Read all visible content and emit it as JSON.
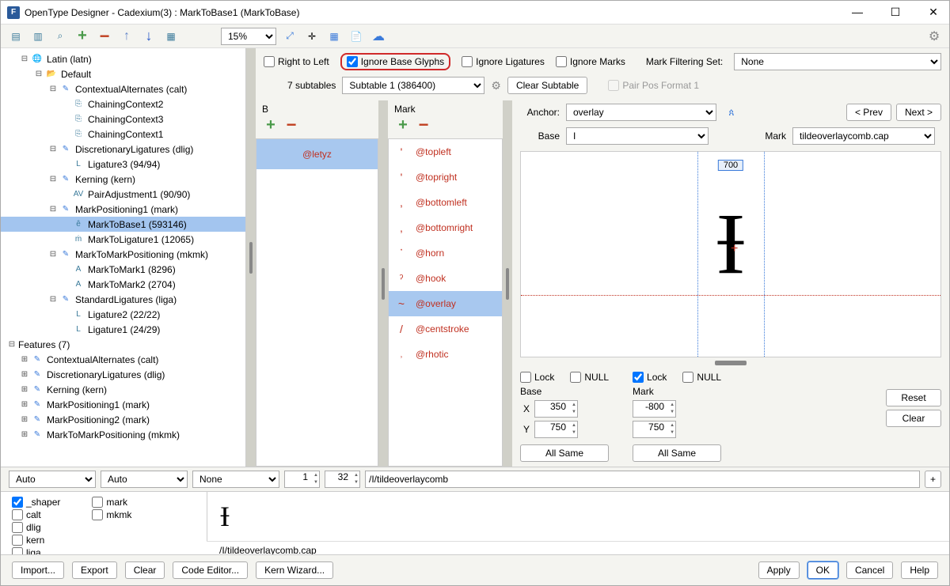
{
  "title": "OpenType Designer - Cadexium(3) : MarkToBase1 (MarkToBase)",
  "zoom": "15%",
  "options": {
    "rtl": "Right to Left",
    "ignoreBase": "Ignore Base Glyphs",
    "ignoreLig": "Ignore Ligatures",
    "ignoreMarks": "Ignore Marks",
    "mfs_label": "Mark Filtering Set:",
    "mfs_value": "None"
  },
  "subtables_label": "7 subtables",
  "subtable_sel": "Subtable 1 (386400)",
  "clear_subtable": "Clear Subtable",
  "pairpos": "Pair Pos Format 1",
  "tree": {
    "latin": "Latin (latn)",
    "default": "Default",
    "calt": "ContextualAlternates (calt)",
    "cc2": "ChainingContext2",
    "cc3": "ChainingContext3",
    "cc1": "ChainingContext1",
    "dlig": "DiscretionaryLigatures (dlig)",
    "lig3": "Ligature3 (94/94)",
    "kern": "Kerning (kern)",
    "pair1": "PairAdjustment1 (90/90)",
    "mp1": "MarkPositioning1 (mark)",
    "mtb1": "MarkToBase1 (593146)",
    "mtl1": "MarkToLigature1 (12065)",
    "mmk": "MarkToMarkPositioning (mkmk)",
    "mm1": "MarkToMark1 (8296)",
    "mm2": "MarkToMark2 (2704)",
    "liga": "StandardLigatures (liga)",
    "lig2b": "Ligature2 (22/22)",
    "lig1b": "Ligature1 (24/29)",
    "features": "Features (7)",
    "f_calt": "ContextualAlternates (calt)",
    "f_dlig": "DiscretionaryLigatures (dlig)",
    "f_kern": "Kerning (kern)",
    "f_mp1": "MarkPositioning1 (mark)",
    "f_mp2": "MarkPositioning2 (mark)",
    "f_mmk": "MarkToMarkPositioning (mkmk)"
  },
  "colB": {
    "label": "B",
    "item": "@letyz"
  },
  "colM": {
    "label": "Mark",
    "items": [
      "@topleft",
      "@topright",
      "@bottomleft",
      "@bottomright",
      "@horn",
      "@hook",
      "@overlay",
      "@centstroke",
      "@rhotic"
    ]
  },
  "anchor": {
    "label": "Anchor:",
    "value": "overlay"
  },
  "base": {
    "label": "Base",
    "value": "I"
  },
  "mark": {
    "label": "Mark",
    "value": "tildeoverlaycomb.cap"
  },
  "nav": {
    "prev": "< Prev",
    "next": "Next >"
  },
  "metric": "700",
  "coords": {
    "lockBase": "Lock",
    "nullBase": "NULL",
    "lockMark": "Lock",
    "nullMark": "NULL",
    "baseLbl": "Base",
    "markLbl": "Mark",
    "xLbl": "X",
    "yLbl": "Y",
    "bx": "350",
    "by": "750",
    "mx": "-800",
    "my": "750",
    "allsame": "All Same",
    "reset": "Reset",
    "clear": "Clear"
  },
  "bottombar": {
    "auto1": "Auto",
    "auto2": "Auto",
    "none": "None",
    "num1": "1",
    "num2": "32",
    "input": "/I/tildeoverlaycomb",
    "plus": "+"
  },
  "features_chk": {
    "shaper": "_shaper",
    "calt": "calt",
    "dlig": "dlig",
    "kern": "kern",
    "liga": "liga",
    "mark": "mark",
    "mkmk": "mkmk"
  },
  "output": "/I/tildeoverlaycomb.cap",
  "buttons": {
    "import": "Import...",
    "export": "Export",
    "clear": "Clear",
    "code": "Code Editor...",
    "kern": "Kern Wizard...",
    "apply": "Apply",
    "ok": "OK",
    "cancel": "Cancel",
    "help": "Help"
  }
}
